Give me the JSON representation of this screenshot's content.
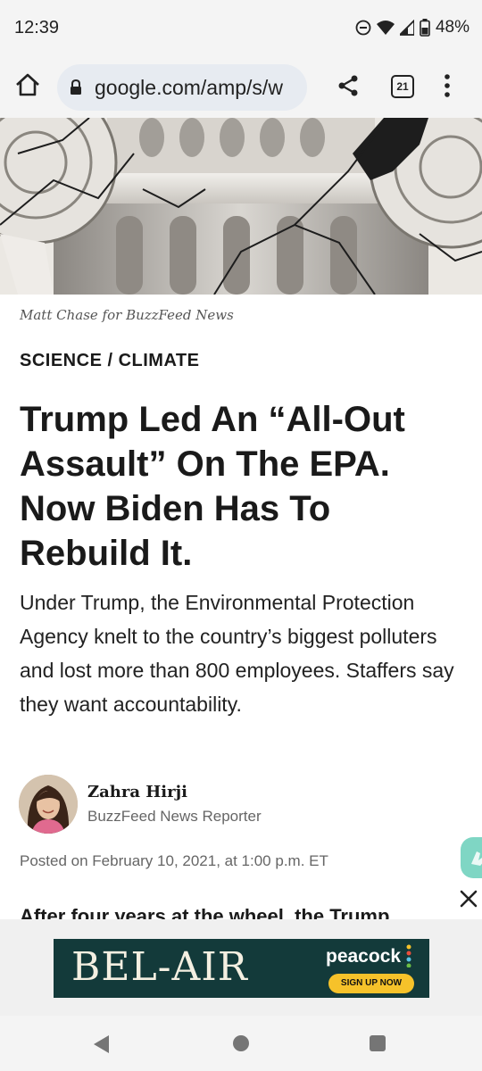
{
  "status_bar": {
    "time": "12:39",
    "battery": "48%"
  },
  "browser": {
    "url": "google.com/amp/s/w",
    "tab_count": "21"
  },
  "article": {
    "photo_credit": "Matt Chase for BuzzFeed News",
    "category": "SCIENCE / CLIMATE",
    "headline": "Trump Led An “All-Out Assault” On The EPA. Now Biden Has To Rebuild It.",
    "dek": "Under Trump, the Environmental Protection Agency knelt to the country’s biggest polluters and lost more than 800 employees. Staffers say they want accountability.",
    "author_name": "Zahra Hirji",
    "author_role": "BuzzFeed News Reporter",
    "posted": "Posted on February 10, 2021, at 1:00 p.m. ET",
    "body_peek": "After four years at the wheel, the Trump"
  },
  "ad": {
    "title": "BEL-AIR",
    "brand": "peacock",
    "cta": "SIGN UP NOW",
    "colors": {
      "background": "#133a3a",
      "cta": "#f6c22a"
    }
  },
  "icons": [
    "dnd-icon",
    "wifi-icon",
    "signal-icon",
    "battery-icon",
    "home-icon",
    "lock-icon",
    "share-icon",
    "tabs-icon",
    "menu-icon",
    "close-icon",
    "back-icon"
  ]
}
